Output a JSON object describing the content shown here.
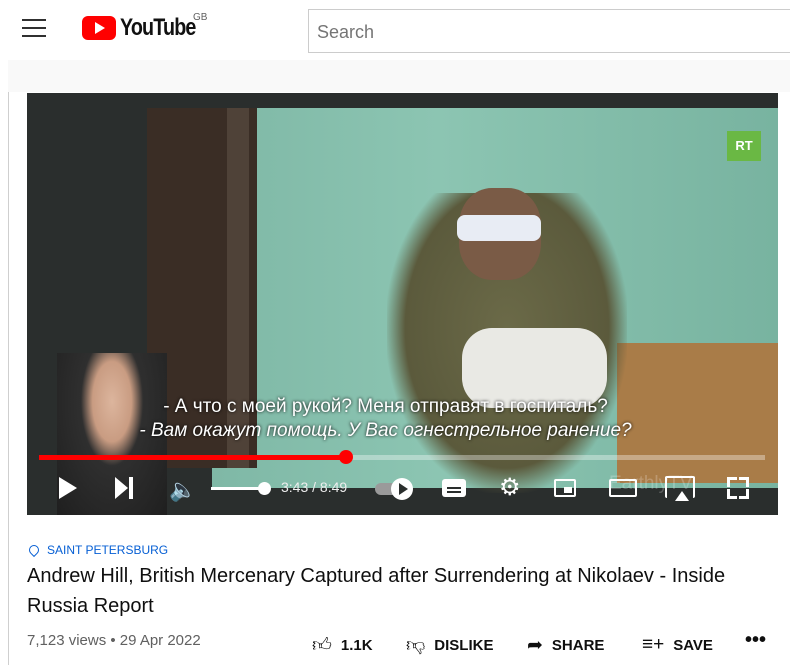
{
  "header": {
    "logo_text": "YouTube",
    "region": "GB",
    "search_placeholder": "Search"
  },
  "video": {
    "channel_badge": "RT",
    "subtitle_line1": "- А что с моей рукой? Меня отправят в госпиталь?",
    "subtitle_line2": "- Вам окажут помощь. У Вас огнестрельное ранение?",
    "watermark": "EarthlyTV",
    "time_display": "3:43 / 8:49",
    "progress_fraction": 0.423,
    "volume_fraction": 1.0,
    "autoplay": true
  },
  "info": {
    "location": "SAINT PETERSBURG",
    "title": "Andrew Hill, British Mercenary Captured after Surrendering at Nikolaev - Inside Russia Report",
    "views_date": "7,123 views • 29 Apr 2022"
  },
  "actions": {
    "like_count": "1.1K",
    "dislike_label": "DISLIKE",
    "share_label": "SHARE",
    "save_label": "SAVE",
    "more_label": "•••"
  },
  "icons": {
    "like": "thumb-up-icon",
    "dislike": "thumb-down-icon",
    "share": "share-icon",
    "save": "playlist-add-icon"
  },
  "colors": {
    "accent": "#ff0000",
    "link": "#065fd4"
  }
}
